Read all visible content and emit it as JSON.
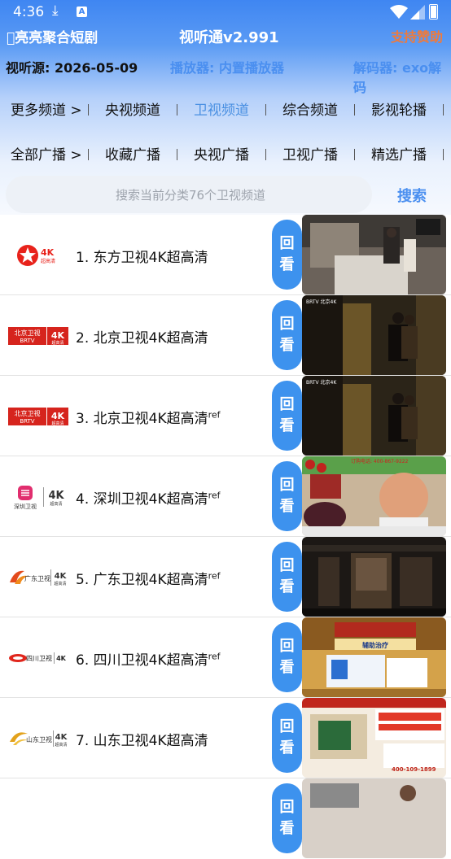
{
  "status_bar": {
    "time": "4:36",
    "download_icon": "download-icon",
    "a_badge": "A"
  },
  "header": {
    "left_title": "\u0000亮亮聚合短剧",
    "app_title": "视听通v2.991",
    "support_link": "支持赞助"
  },
  "info": {
    "source": "视听源: 2026-05-09",
    "player": "播放器: 内置播放器",
    "decoder": "解码器: exo解码"
  },
  "channel_tabs": [
    {
      "label": "更多频道 >",
      "active": false
    },
    {
      "label": "央视频道",
      "active": false
    },
    {
      "label": "卫视频道",
      "active": true
    },
    {
      "label": "综合频道",
      "active": false
    },
    {
      "label": "影视轮播",
      "active": false
    }
  ],
  "radio_tabs": [
    {
      "label": "全部广播 >"
    },
    {
      "label": "收藏广播"
    },
    {
      "label": "央视广播"
    },
    {
      "label": "卫视广播"
    },
    {
      "label": "精选广播"
    }
  ],
  "search": {
    "placeholder": "搜索当前分类76个卫视频道",
    "button_label": "搜索"
  },
  "replay_label": {
    "line1": "回",
    "line2": "看"
  },
  "channels": [
    {
      "index": "1.",
      "name": "东方卫视4K超高清",
      "ref": "",
      "logo": "dragon-tv-logo",
      "logo_badge": "4K",
      "logo_sub": "超高清"
    },
    {
      "index": "2.",
      "name": "北京卫视4K超高清",
      "ref": "",
      "logo": "brtv-logo",
      "logo_text": "北京卫视",
      "logo_sub_text": "BRTV",
      "logo_badge": "4K",
      "logo_sub": "超高清"
    },
    {
      "index": "3.",
      "name": "北京卫视4K超高清",
      "ref": "ref",
      "logo": "brtv-logo",
      "logo_text": "北京卫视",
      "logo_sub_text": "BRTV",
      "logo_badge": "4K",
      "logo_sub": "超高清"
    },
    {
      "index": "4.",
      "name": "深圳卫视4K超高清",
      "ref": "ref",
      "logo": "shenzhen-tv-logo",
      "logo_text": "深圳卫视",
      "logo_badge": "4K",
      "logo_sub": "超高清"
    },
    {
      "index": "5.",
      "name": "广东卫视4K超高清",
      "ref": "ref",
      "logo": "guangdong-tv-logo",
      "logo_text": "广东卫视",
      "logo_badge": "4K",
      "logo_sub": "超高清"
    },
    {
      "index": "6.",
      "name": "四川卫视4K超高清",
      "ref": "ref",
      "logo": "sichuan-tv-logo",
      "logo_text": "四川卫视",
      "logo_badge": "4K"
    },
    {
      "index": "7.",
      "name": "山东卫视4K超高清",
      "ref": "",
      "logo": "shandong-tv-logo",
      "logo_text": "山东卫视",
      "logo_badge": "4K",
      "logo_sub": "超高清"
    }
  ],
  "thumbnails": [
    {
      "overlay": ""
    },
    {
      "overlay": "BRTV 北京4K"
    },
    {
      "overlay": "BRTV 北京4K"
    },
    {
      "overlay": "订购电话: 400-867-9222"
    },
    {
      "overlay": ""
    },
    {
      "overlay": "辅助治疗"
    },
    {
      "overlay": "400-109-1899"
    }
  ],
  "colors": {
    "header_blue": "#3f86f2",
    "accent_blue": "#4a8ff0",
    "replay_blue": "#3d92ee",
    "support_orange": "#f07a3a",
    "active_tab": "#4a90e2"
  }
}
